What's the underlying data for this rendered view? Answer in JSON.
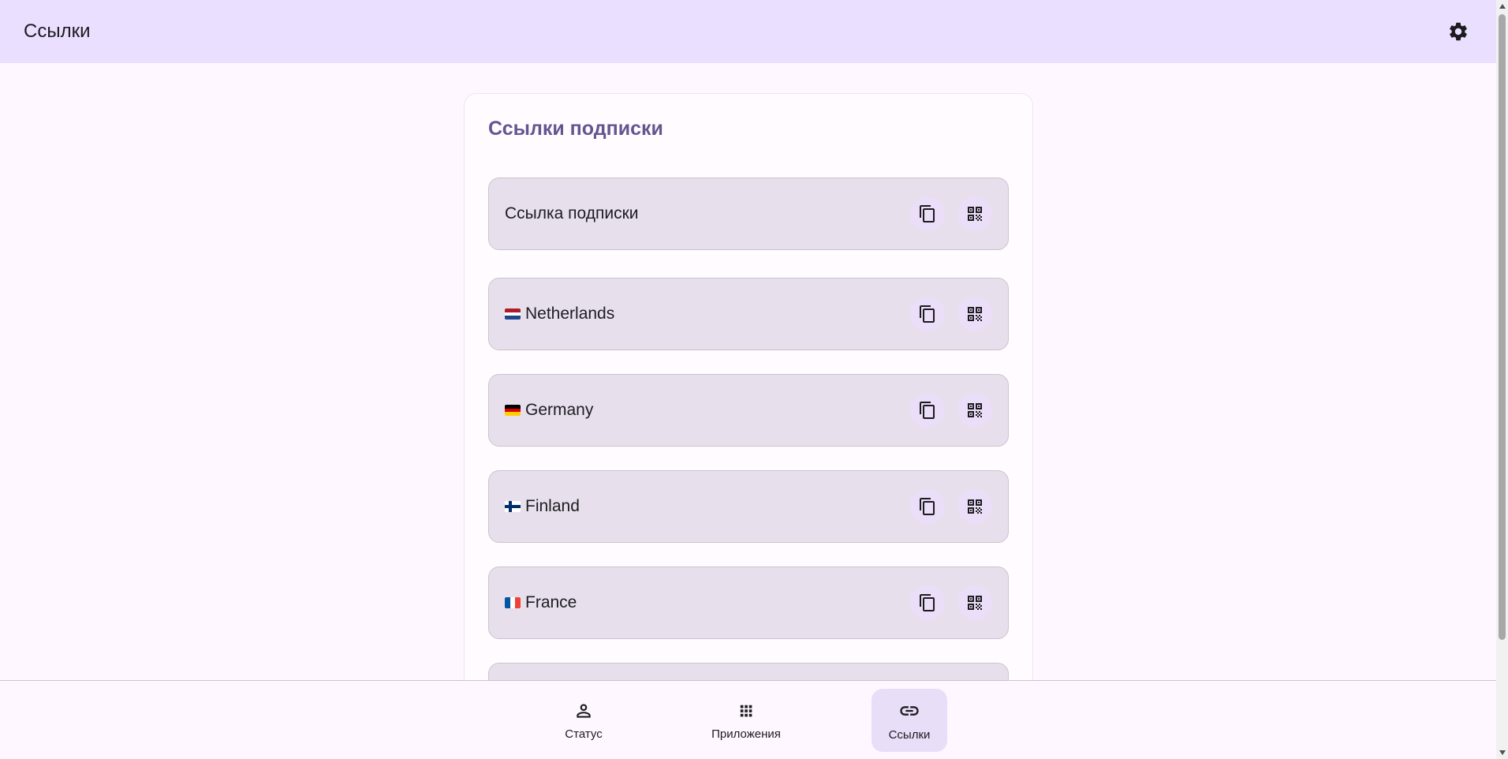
{
  "header": {
    "title": "Ссылки",
    "settings_icon": "gear-icon"
  },
  "card": {
    "title": "Ссылки подписки",
    "links": [
      {
        "label": "Ссылка подписки",
        "flag": null
      },
      {
        "label": "Netherlands",
        "flag": "nl"
      },
      {
        "label": "Germany",
        "flag": "de"
      },
      {
        "label": "Finland",
        "flag": "fi"
      },
      {
        "label": "France",
        "flag": "fr"
      }
    ],
    "copy_icon": "copy-icon",
    "qr_icon": "qr-code-icon"
  },
  "bottom_nav": {
    "items": [
      {
        "label": "Статус",
        "icon": "person-icon",
        "active": false
      },
      {
        "label": "Приложения",
        "icon": "apps-grid-icon",
        "active": false
      },
      {
        "label": "Ссылки",
        "icon": "link-icon",
        "active": true
      }
    ]
  },
  "colors": {
    "header_bg": "#eadfff",
    "accent_title": "#65558f",
    "row_bg": "#e7e0ec",
    "active_nav": "#e8def8"
  }
}
